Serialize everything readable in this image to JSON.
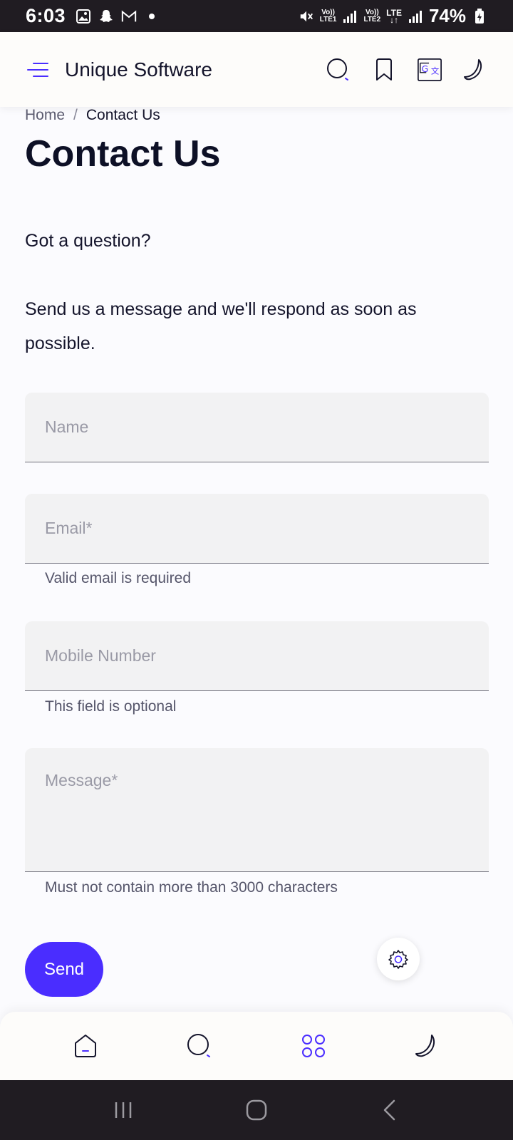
{
  "status_bar": {
    "time": "6:03",
    "battery": "74%",
    "sim1_label_top": "Vo))",
    "sim1_label_bottom": "LTE1",
    "sim2_label_top": "Vo))",
    "sim2_label_bottom": "LTE2",
    "net_label": "LTE"
  },
  "app_bar": {
    "title": "Unique Software",
    "icons": [
      "menu-icon",
      "search-icon",
      "bookmark-icon",
      "translate-icon",
      "moon-icon"
    ]
  },
  "breadcrumb": {
    "home": "Home",
    "separator": "/",
    "current": "Contact Us"
  },
  "page": {
    "title": "Contact Us",
    "question": "Got a question?",
    "intro": "Send us a message and we'll respond as soon as possible."
  },
  "form": {
    "name_placeholder": "Name",
    "email_placeholder": "Email*",
    "email_helper": "Valid email is required",
    "mobile_placeholder": "Mobile Number",
    "mobile_helper": "This field is optional",
    "message_placeholder": "Message*",
    "message_helper": "Must not contain more than 3000 characters",
    "send_label": "Send"
  },
  "bottom_nav": {
    "items": [
      "home-icon",
      "search-icon",
      "apps-icon",
      "moon-icon"
    ]
  },
  "colors": {
    "accent": "#4a2dff",
    "status_bar": "#201c22",
    "field_bg": "#f2f2f3"
  }
}
